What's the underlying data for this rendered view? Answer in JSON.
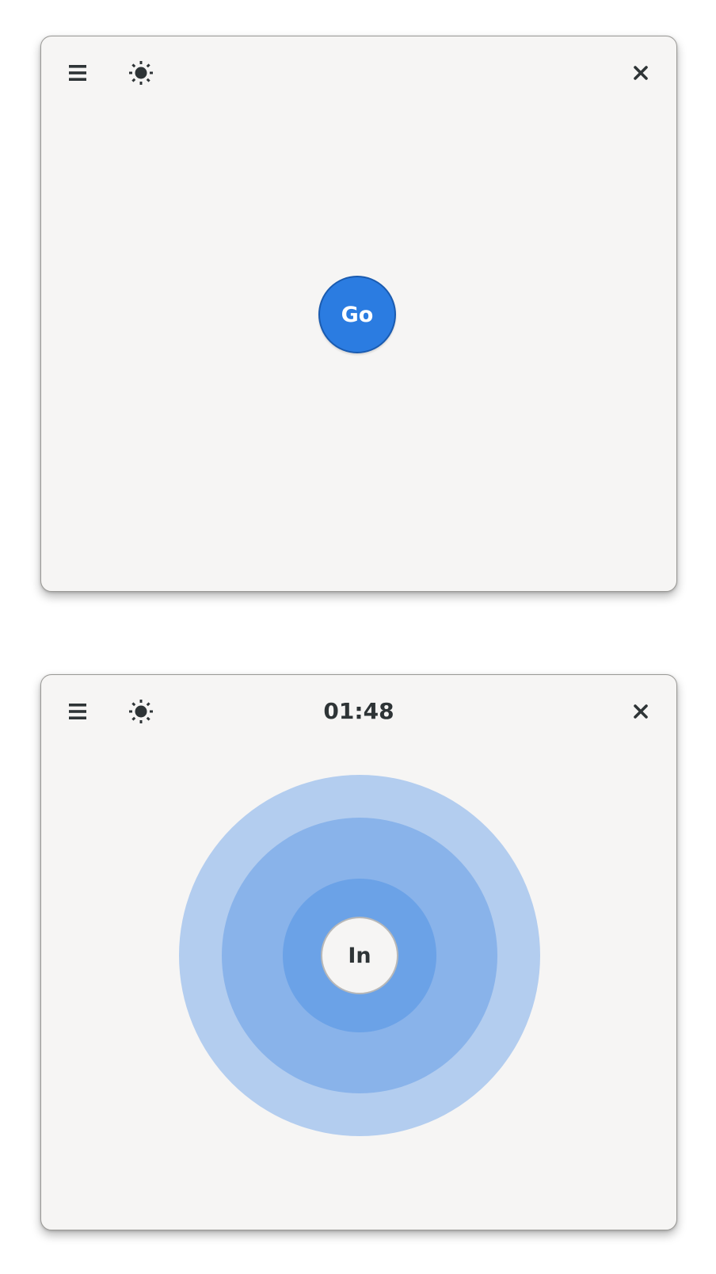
{
  "windows": [
    {
      "header": {
        "menu_icon": "hamburger-menu-icon",
        "theme_icon": "sun-icon",
        "close_icon": "close-icon",
        "title": ""
      },
      "main": {
        "start_button_label": "Go"
      }
    },
    {
      "header": {
        "menu_icon": "hamburger-menu-icon",
        "theme_icon": "sun-icon",
        "close_icon": "close-icon",
        "timer": "01:48"
      },
      "main": {
        "phase_button_label": "In"
      }
    }
  ],
  "colors": {
    "accent": "#2b7ce1",
    "window_bg": "#f6f5f4",
    "icon": "#2e3436",
    "ring_outer": "#b3cdef",
    "ring_middle": "#89b3ea",
    "ring_inner": "#6ba2e7"
  }
}
